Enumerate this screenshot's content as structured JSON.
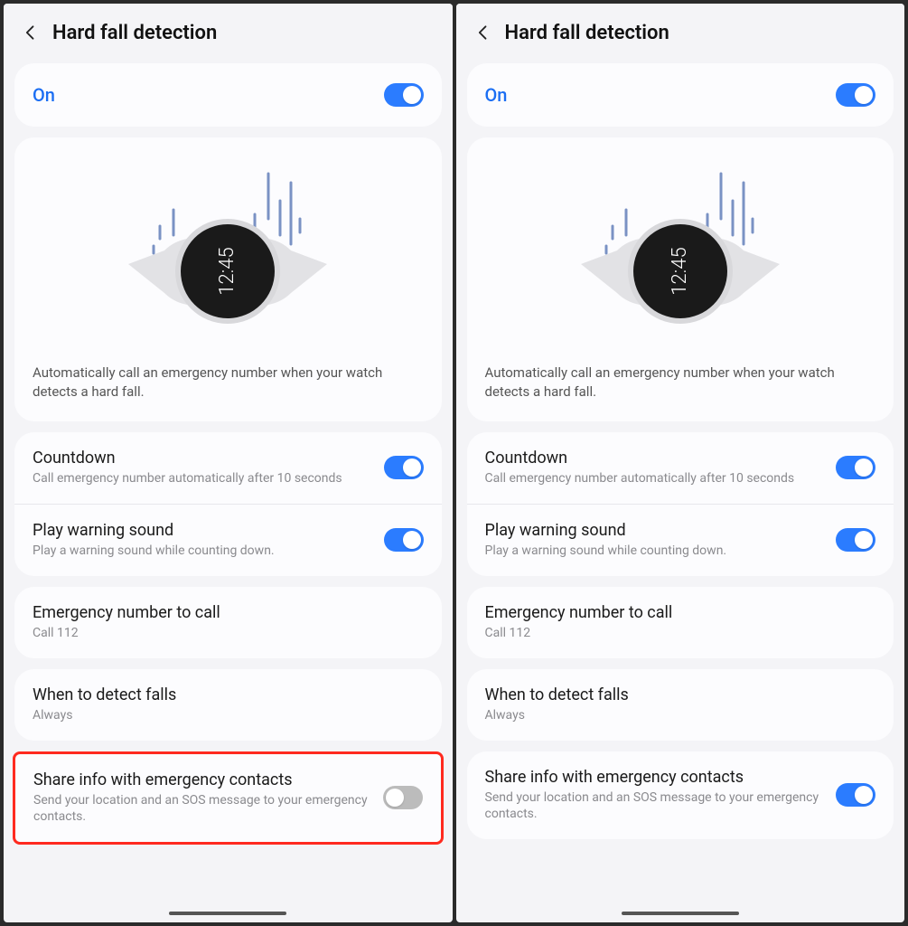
{
  "left": {
    "header": {
      "title": "Hard fall detection"
    },
    "master": {
      "label": "On",
      "state": true
    },
    "hero": {
      "desc": "Automatically call an emergency number when your watch detects a hard fall.",
      "watch_time": "12:45"
    },
    "countdown": {
      "title": "Countdown",
      "sub": "Call emergency number automatically after 10 seconds",
      "state": true
    },
    "warning": {
      "title": "Play warning sound",
      "sub": "Play a warning sound while counting down.",
      "state": true
    },
    "number": {
      "title": "Emergency number to call",
      "sub": "Call 112"
    },
    "detect": {
      "title": "When to detect falls",
      "sub": "Always"
    },
    "share": {
      "title": "Share info with emergency contacts",
      "sub": "Send your location and an SOS message to your emergency contacts.",
      "state": false
    }
  },
  "right": {
    "header": {
      "title": "Hard fall detection"
    },
    "master": {
      "label": "On",
      "state": true
    },
    "hero": {
      "desc": "Automatically call an emergency number when your watch detects a hard fall.",
      "watch_time": "12:45"
    },
    "countdown": {
      "title": "Countdown",
      "sub": "Call emergency number automatically after 10 seconds",
      "state": true
    },
    "warning": {
      "title": "Play warning sound",
      "sub": "Play a warning sound while counting down.",
      "state": true
    },
    "number": {
      "title": "Emergency number to call",
      "sub": "Call 112"
    },
    "detect": {
      "title": "When to detect falls",
      "sub": "Always"
    },
    "share": {
      "title": "Share info with emergency contacts",
      "sub": "Send your location and an SOS message to your emergency contacts.",
      "state": true
    }
  }
}
